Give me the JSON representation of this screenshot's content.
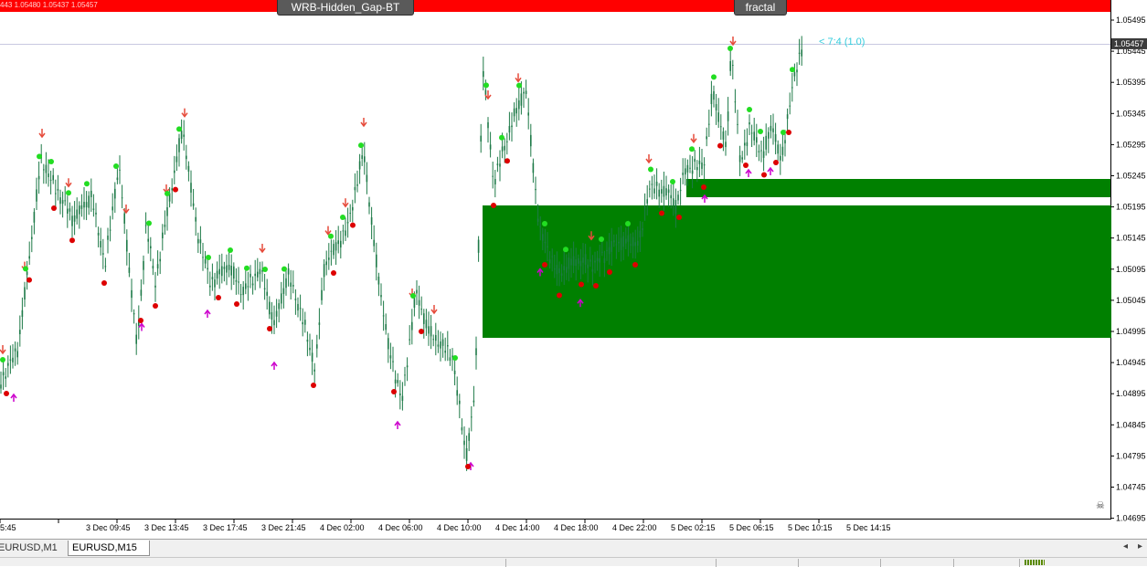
{
  "header": {
    "quote_text": "443 1.05480 1.05437 1.05457",
    "indicator_buttons": [
      "WRB-Hidden_Gap-BT",
      "fractal"
    ]
  },
  "price_axis": {
    "labels": [
      "1.05495",
      "1.05445",
      "1.05395",
      "1.05345",
      "1.05295",
      "1.05245",
      "1.05195",
      "1.05145",
      "1.05095",
      "1.05045",
      "1.04995",
      "1.04945",
      "1.04895",
      "1.04845",
      "1.04795",
      "1.04745",
      "1.04695"
    ],
    "current_price": "1.05457",
    "current_price_bg": "#3c3c3c"
  },
  "time_axis": {
    "labels": [
      "5:45",
      "3 Dec 09:45",
      "3 Dec 13:45",
      "3 Dec 17:45",
      "3 Dec 21:45",
      "4 Dec 02:00",
      "4 Dec 06:00",
      "4 Dec 10:00",
      "4 Dec 14:00",
      "4 Dec 18:00",
      "4 Dec 22:00",
      "5 Dec 02:15",
      "5 Dec 06:15",
      "5 Dec 10:15",
      "5 Dec 14:15"
    ]
  },
  "chart": {
    "candle_color": "#1e7a48",
    "zone_color": "#008000",
    "fractal_up_color": "#e64b3b",
    "fractal_down_color": "#cc00cc",
    "dot_high_color": "#22dd22",
    "dot_low_color": "#dd0000",
    "countdown_label": "< 7:4 (1.0)",
    "countdown_color": "#33ccdd"
  },
  "tabs": [
    {
      "label": "EURUSD,M1",
      "active": false
    },
    {
      "label": "EURUSD,M15",
      "active": true
    }
  ]
}
